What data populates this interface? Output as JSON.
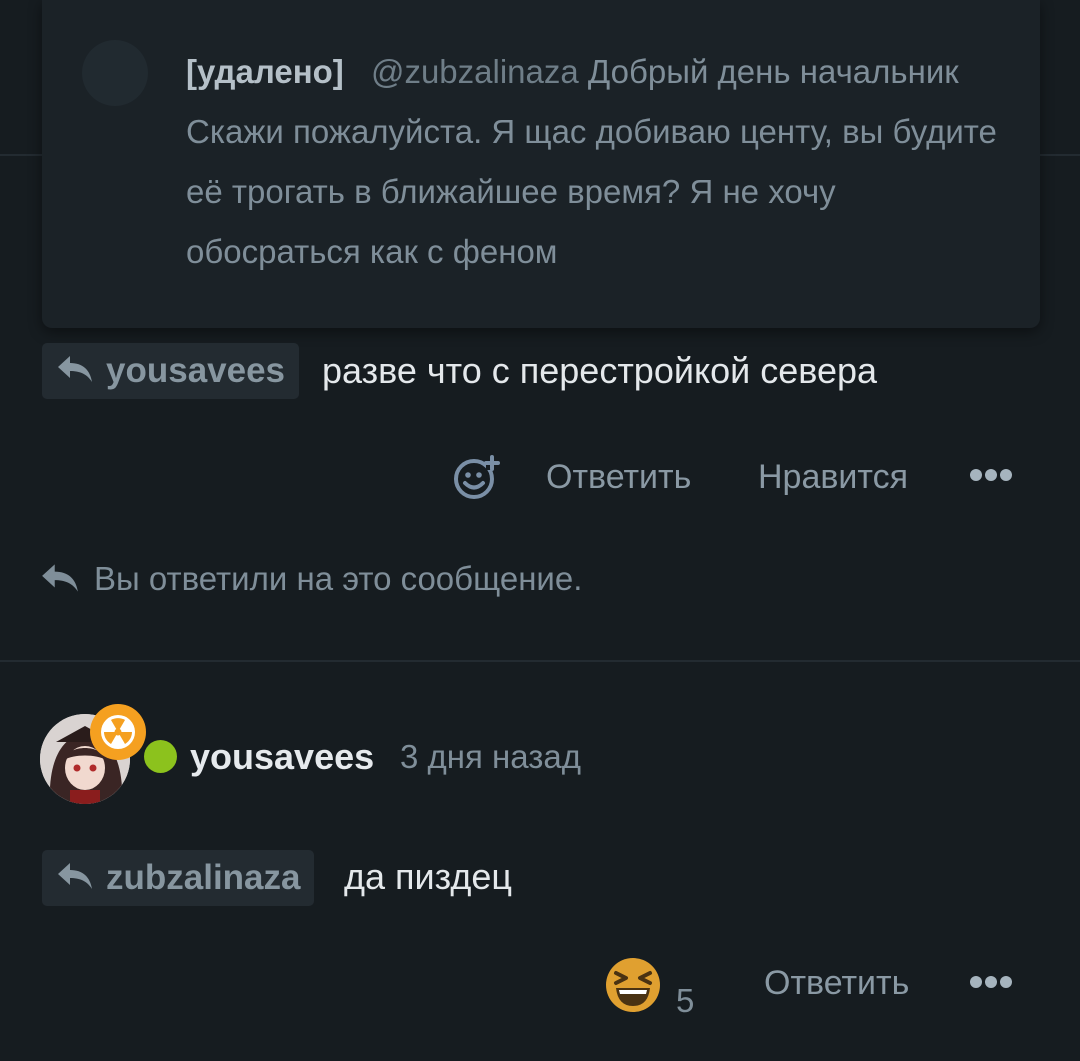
{
  "quoted": {
    "author": "[удалено]",
    "mention": "@zubzalinaza",
    "text": "Добрый день начальник Скажи пожалуйста. Я щас добиваю центу, вы будите её трогать в ближайшее время? Я не хочу обосраться как с феном"
  },
  "reply1": {
    "reply_to": "yousavees",
    "text": "разве что с перестройкой севера",
    "actions": {
      "reply": "Ответить",
      "like": "Нравится"
    }
  },
  "notice": "Вы ответили на это сообщение.",
  "comment": {
    "username": "yousavees",
    "time": "3 дня назад",
    "reply_to": "zubzalinaza",
    "text": "да пиздец",
    "reaction_count": "5",
    "actions": {
      "reply": "Ответить"
    }
  },
  "colors": {
    "background": "#161c20",
    "online": "#8cc21d",
    "badge": "#f5a020",
    "emoji": "#e0a030"
  }
}
